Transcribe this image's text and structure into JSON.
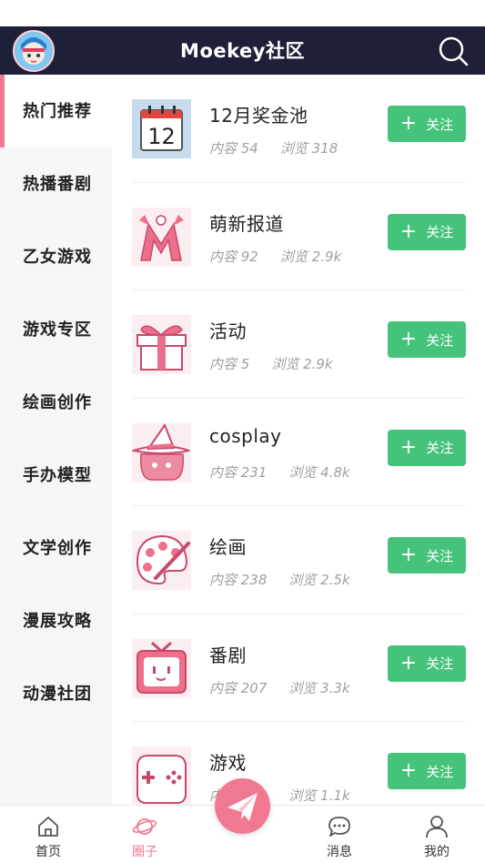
{
  "header": {
    "title": "Moekey社区"
  },
  "sidebar": {
    "items": [
      {
        "label": "热门推荐",
        "active": true
      },
      {
        "label": "热播番剧"
      },
      {
        "label": "乙女游戏"
      },
      {
        "label": "游戏专区"
      },
      {
        "label": "绘画创作"
      },
      {
        "label": "手办模型"
      },
      {
        "label": "文学创作"
      },
      {
        "label": "漫展攻略"
      },
      {
        "label": "动漫社团"
      }
    ]
  },
  "list": {
    "follow_label": "关注",
    "items": [
      {
        "name": "12月奖金池",
        "content": "内容 54",
        "views": "浏览 318",
        "icon": "calendar-icon",
        "badge": "12"
      },
      {
        "name": "萌新报道",
        "content": "内容 92",
        "views": "浏览 2.9k",
        "icon": "letter-m-icon"
      },
      {
        "name": "活动",
        "content": "内容 5",
        "views": "浏览 2.9k",
        "icon": "gift-icon"
      },
      {
        "name": "cosplay",
        "content": "内容 231",
        "views": "浏览 4.8k",
        "icon": "witch-hat-icon"
      },
      {
        "name": "绘画",
        "content": "内容 238",
        "views": "浏览 2.5k",
        "icon": "palette-icon"
      },
      {
        "name": "番剧",
        "content": "内容 207",
        "views": "浏览 3.3k",
        "icon": "tv-icon"
      },
      {
        "name": "游戏",
        "content": "内容 303",
        "views": "浏览 1.1k",
        "icon": "gamepad-icon"
      }
    ]
  },
  "tabbar": {
    "tabs": [
      {
        "label": "首页",
        "icon": "home-icon"
      },
      {
        "label": "圈子",
        "icon": "planet-icon",
        "active": true
      },
      {
        "label": "",
        "icon": "paper-plane-icon"
      },
      {
        "label": "消息",
        "icon": "chat-icon"
      },
      {
        "label": "我的",
        "icon": "person-icon"
      }
    ]
  },
  "colors": {
    "header_bg": "#1e2038",
    "accent_pink": "#f07890",
    "follow_green": "#46c37b",
    "sidebar_bg": "#f6f6f8"
  }
}
